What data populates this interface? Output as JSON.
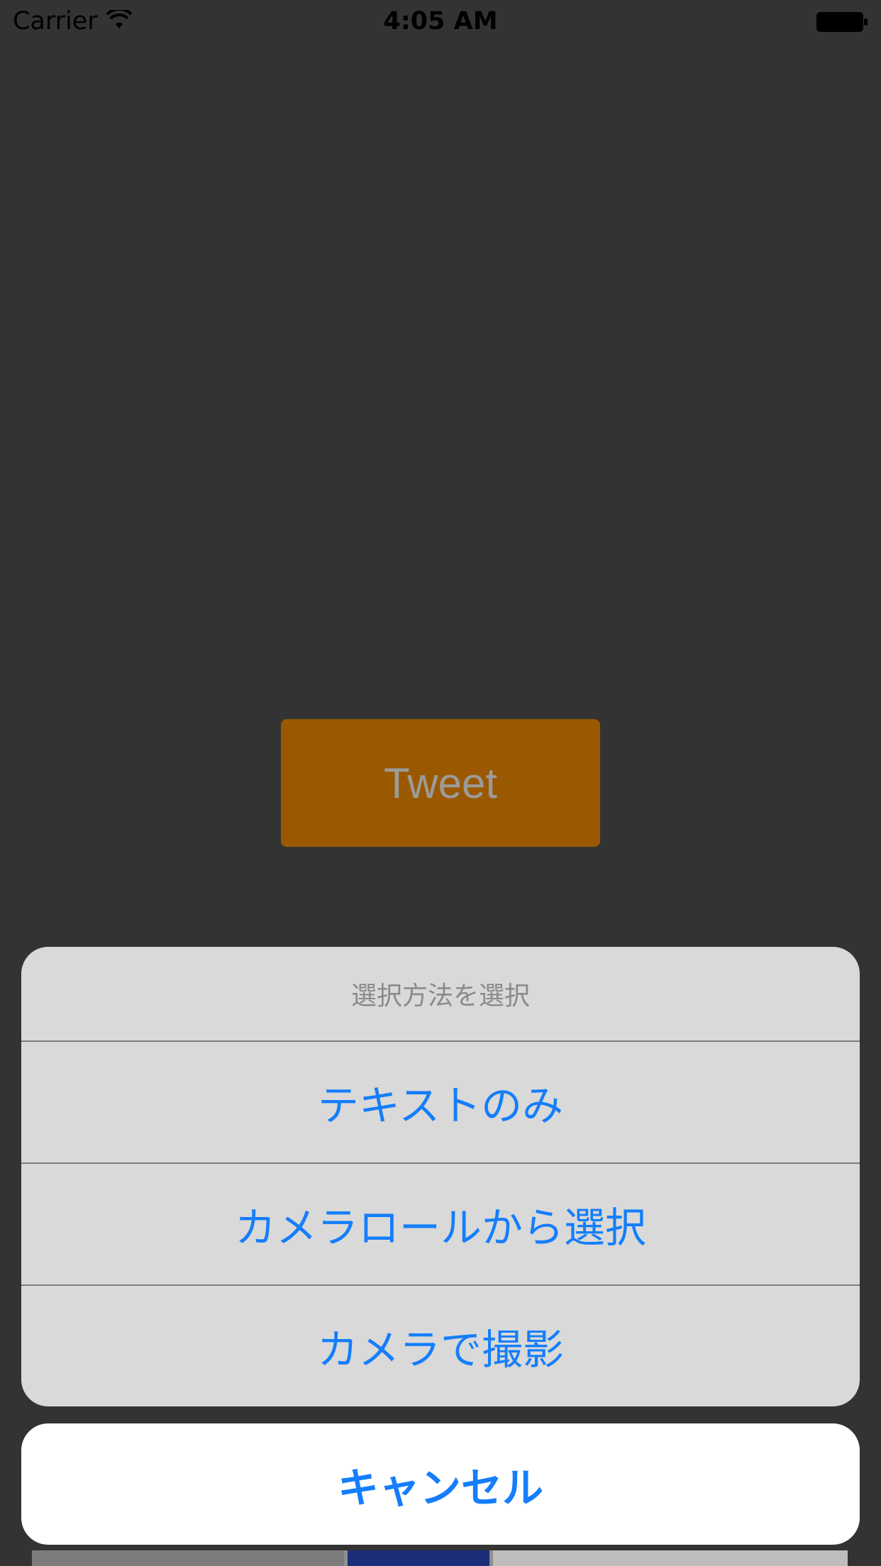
{
  "status_bar": {
    "carrier": "Carrier",
    "time": "4:05 AM"
  },
  "main": {
    "tweet_label": "Tweet"
  },
  "action_sheet": {
    "title": "選択方法を選択",
    "options": [
      {
        "label": "テキストのみ"
      },
      {
        "label": "カメラロールから選択"
      },
      {
        "label": "カメラで撮影"
      }
    ],
    "cancel_label": "キャンセル"
  },
  "colors": {
    "background": "#333333",
    "tweet_button": "#9a5900",
    "action_text": "#147efb",
    "sheet_background": "#d9d9d9"
  }
}
